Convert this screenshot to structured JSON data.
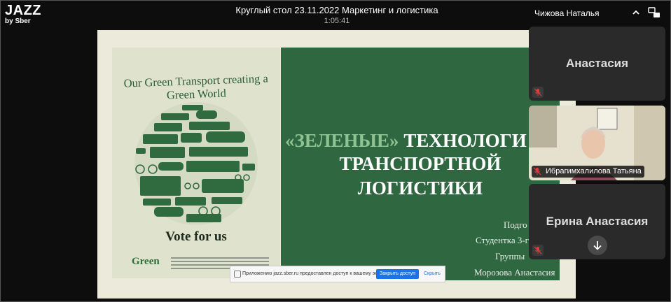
{
  "app": {
    "brand": "JAZZ",
    "brand_sub": "by Sber"
  },
  "meeting": {
    "title": "Круглый стол 23.11.2022 Маркетинг и логистика",
    "elapsed": "1:05:41"
  },
  "panel": {
    "active_speaker": "Чижова Наталья"
  },
  "slide": {
    "poster_title": "Our Green Transport creating a Green World",
    "poster_vote": "Vote for us",
    "poster_logo": "Green",
    "heading_quote": "«ЗЕЛЕНЫЕ»",
    "heading_word1": "ТЕХНОЛОГИ",
    "heading_line2": "ТРАНСПОРТНОЙ",
    "heading_line3": "ЛОГИСТИКИ",
    "author_prefix": "Подго",
    "author_student": "Студентка 3-г",
    "author_group": "Группы",
    "author_name": "Морозова Анастасия"
  },
  "screen_share_banner": {
    "message": "Приложению jazz.sber.ru предоставлен доступ к вашему экрану.",
    "stop_label": "Закрыть доступ",
    "hide_label": "Скрыть"
  },
  "participants": [
    {
      "name": "Анастасия",
      "muted": true,
      "video": false
    },
    {
      "name": "Ибрагимхалилова Татьяна",
      "muted": true,
      "video": true
    },
    {
      "name": "Ерина Анастасия",
      "muted": true,
      "video": false
    }
  ],
  "icons": {
    "mic_muted": "mic-off-icon",
    "collapse": "chevron-up-icon",
    "swap": "swap-layout-icon",
    "scroll": "arrow-down-icon"
  },
  "colors": {
    "slide_green": "#2f6840",
    "poster_bg": "#dfe3cd",
    "tile_bg": "#2a2a2a",
    "mute_red": "#e23b3b",
    "accent_blue": "#1a73e8"
  }
}
